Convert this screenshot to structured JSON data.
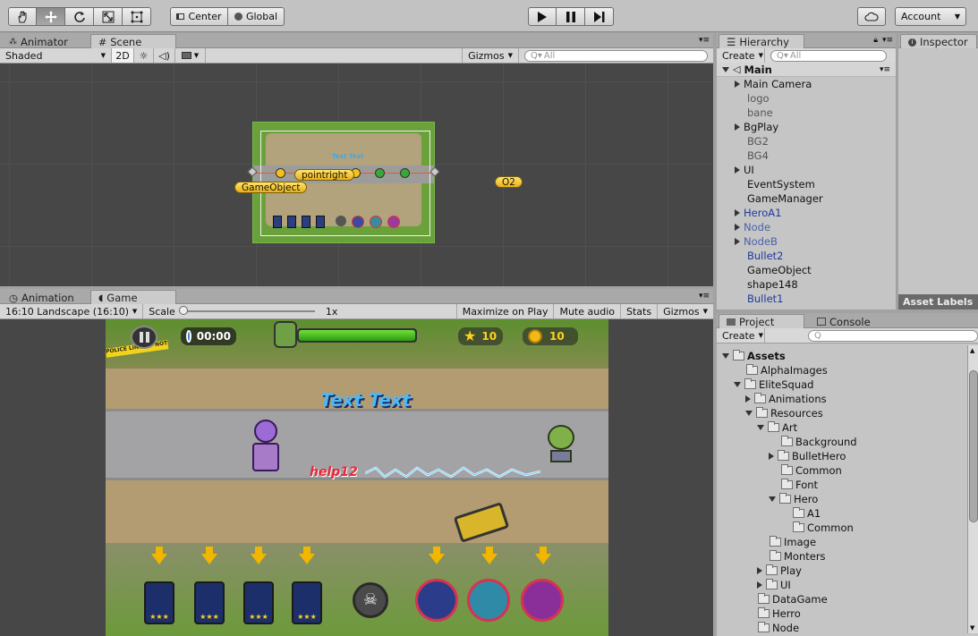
{
  "toolbar": {
    "tools": [
      "hand-icon",
      "move-icon",
      "rotate-icon",
      "scale-icon",
      "rect-tool-icon"
    ],
    "pivot_label": "Center",
    "space_label": "Global",
    "play_icon": "play-icon",
    "pause_icon": "pause-icon",
    "step_icon": "step-icon",
    "account_label": "Account"
  },
  "scene_panel": {
    "tabs": [
      "Animator",
      "Scene"
    ],
    "shading_mode": "Shaded",
    "mode_2d": "2D",
    "gizmos_label": "Gizmos",
    "search_placeholder": "All",
    "labels": {
      "pointright": "pointright",
      "gameobject": "GameObject",
      "o2": "O2",
      "text": "Text Text"
    }
  },
  "game_panel": {
    "tabs": [
      "Animation",
      "Game"
    ],
    "aspect": "16:10 Landscape (16:10)",
    "scale_label": "Scale",
    "scale_value": "1x",
    "maximize": "Maximize on Play",
    "mute": "Mute audio",
    "stats": "Stats",
    "gizmos": "Gizmos",
    "hud": {
      "timer": "00:00",
      "stars": "10",
      "coins": "10",
      "title": "Text Text",
      "help": "help12",
      "police": "POLICE LINE DO NOT CROSS"
    }
  },
  "hierarchy": {
    "tab": "Hierarchy",
    "create": "Create",
    "search_placeholder": "All",
    "scene_name": "Main",
    "items": [
      {
        "label": "Main Camera",
        "expandable": true,
        "color": "#111111"
      },
      {
        "label": "logo",
        "expandable": false,
        "color": "#555555"
      },
      {
        "label": "bane",
        "expandable": false,
        "color": "#555555"
      },
      {
        "label": "BgPlay",
        "expandable": true,
        "color": "#111111"
      },
      {
        "label": "BG2",
        "expandable": false,
        "color": "#555555"
      },
      {
        "label": "BG4",
        "expandable": false,
        "color": "#555555"
      },
      {
        "label": "UI",
        "expandable": true,
        "color": "#111111"
      },
      {
        "label": "EventSystem",
        "expandable": false,
        "color": "#111111"
      },
      {
        "label": "GameManager",
        "expandable": false,
        "color": "#111111"
      },
      {
        "label": "HeroA1",
        "expandable": true,
        "color": "#1c3a9c"
      },
      {
        "label": "Node",
        "expandable": true,
        "color": "#4a62a8"
      },
      {
        "label": "NodeB",
        "expandable": true,
        "color": "#4a62a8"
      },
      {
        "label": "Bullet2",
        "expandable": false,
        "color": "#1c3a9c"
      },
      {
        "label": "GameObject",
        "expandable": false,
        "color": "#111111"
      },
      {
        "label": "shape148",
        "expandable": false,
        "color": "#111111"
      },
      {
        "label": "Bullet1",
        "expandable": false,
        "color": "#1c3a9c"
      }
    ]
  },
  "inspector": {
    "tab": "Inspector",
    "asset_labels": "Asset Labels"
  },
  "project": {
    "tabs": [
      "Project",
      "Console"
    ],
    "create": "Create",
    "items": [
      {
        "label": "Assets",
        "depth": 0,
        "state": "open",
        "bold": true
      },
      {
        "label": "AlphaImages",
        "depth": 1,
        "state": "none"
      },
      {
        "label": "EliteSquad",
        "depth": 1,
        "state": "open"
      },
      {
        "label": "Animations",
        "depth": 2,
        "state": "closed"
      },
      {
        "label": "Resources",
        "depth": 2,
        "state": "open"
      },
      {
        "label": "Art",
        "depth": 3,
        "state": "open"
      },
      {
        "label": "Background",
        "depth": 4,
        "state": "none"
      },
      {
        "label": "BulletHero",
        "depth": 4,
        "state": "closed"
      },
      {
        "label": "Common",
        "depth": 4,
        "state": "none"
      },
      {
        "label": "Font",
        "depth": 4,
        "state": "none"
      },
      {
        "label": "Hero",
        "depth": 4,
        "state": "open"
      },
      {
        "label": "A1",
        "depth": 5,
        "state": "none"
      },
      {
        "label": "Common",
        "depth": 5,
        "state": "none"
      },
      {
        "label": "Image",
        "depth": 3,
        "state": "none"
      },
      {
        "label": "Monters",
        "depth": 3,
        "state": "none"
      },
      {
        "label": "Play",
        "depth": 3,
        "state": "closed"
      },
      {
        "label": "UI",
        "depth": 3,
        "state": "closed"
      },
      {
        "label": "DataGame",
        "depth": 2,
        "state": "none"
      },
      {
        "label": "Herro",
        "depth": 2,
        "state": "none"
      },
      {
        "label": "Node",
        "depth": 2,
        "state": "none"
      }
    ]
  }
}
